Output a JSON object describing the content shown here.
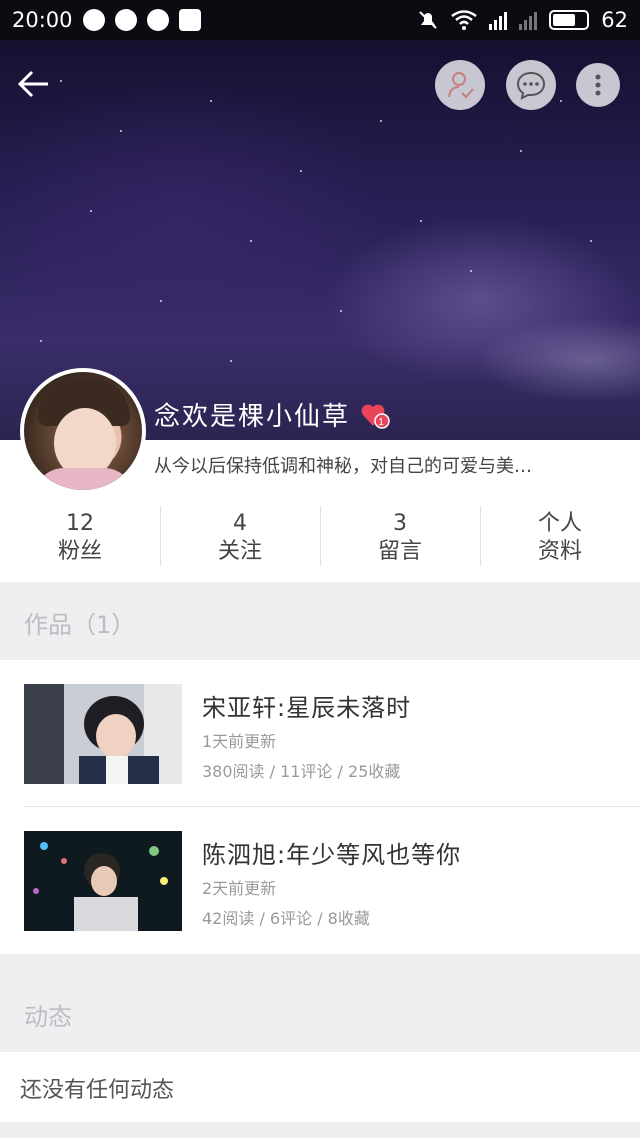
{
  "status_bar": {
    "time": "20:00",
    "battery": "62"
  },
  "profile": {
    "name": "念欢是棵小仙草",
    "badge_count": "1",
    "bio": "从今以后保持低调和神秘，对自己的可爱与美…"
  },
  "stats": [
    {
      "value": "12",
      "label": "粉丝"
    },
    {
      "value": "4",
      "label": "关注"
    },
    {
      "value": "3",
      "label": "留言"
    },
    {
      "value": "个人",
      "label": "资料"
    }
  ],
  "works_section": {
    "title": "作品（1）"
  },
  "works": [
    {
      "title": "宋亚轩:星辰未落时",
      "updated": "1天前更新",
      "stats": "380阅读 / 11评论 / 25收藏"
    },
    {
      "title": "陈泗旭:年少等风也等你",
      "updated": "2天前更新",
      "stats": "42阅读 / 6评论 / 8收藏"
    }
  ],
  "activity_section": {
    "title": "动态",
    "empty_text": "还没有任何动态"
  },
  "icons": {
    "back": "back-arrow-icon",
    "follow": "user-check-icon",
    "message": "chat-bubble-icon",
    "more": "more-vertical-icon",
    "heart": "heart-badge-icon"
  },
  "colors": {
    "accent": "#e8445a",
    "section_text": "#bdbdc2"
  }
}
